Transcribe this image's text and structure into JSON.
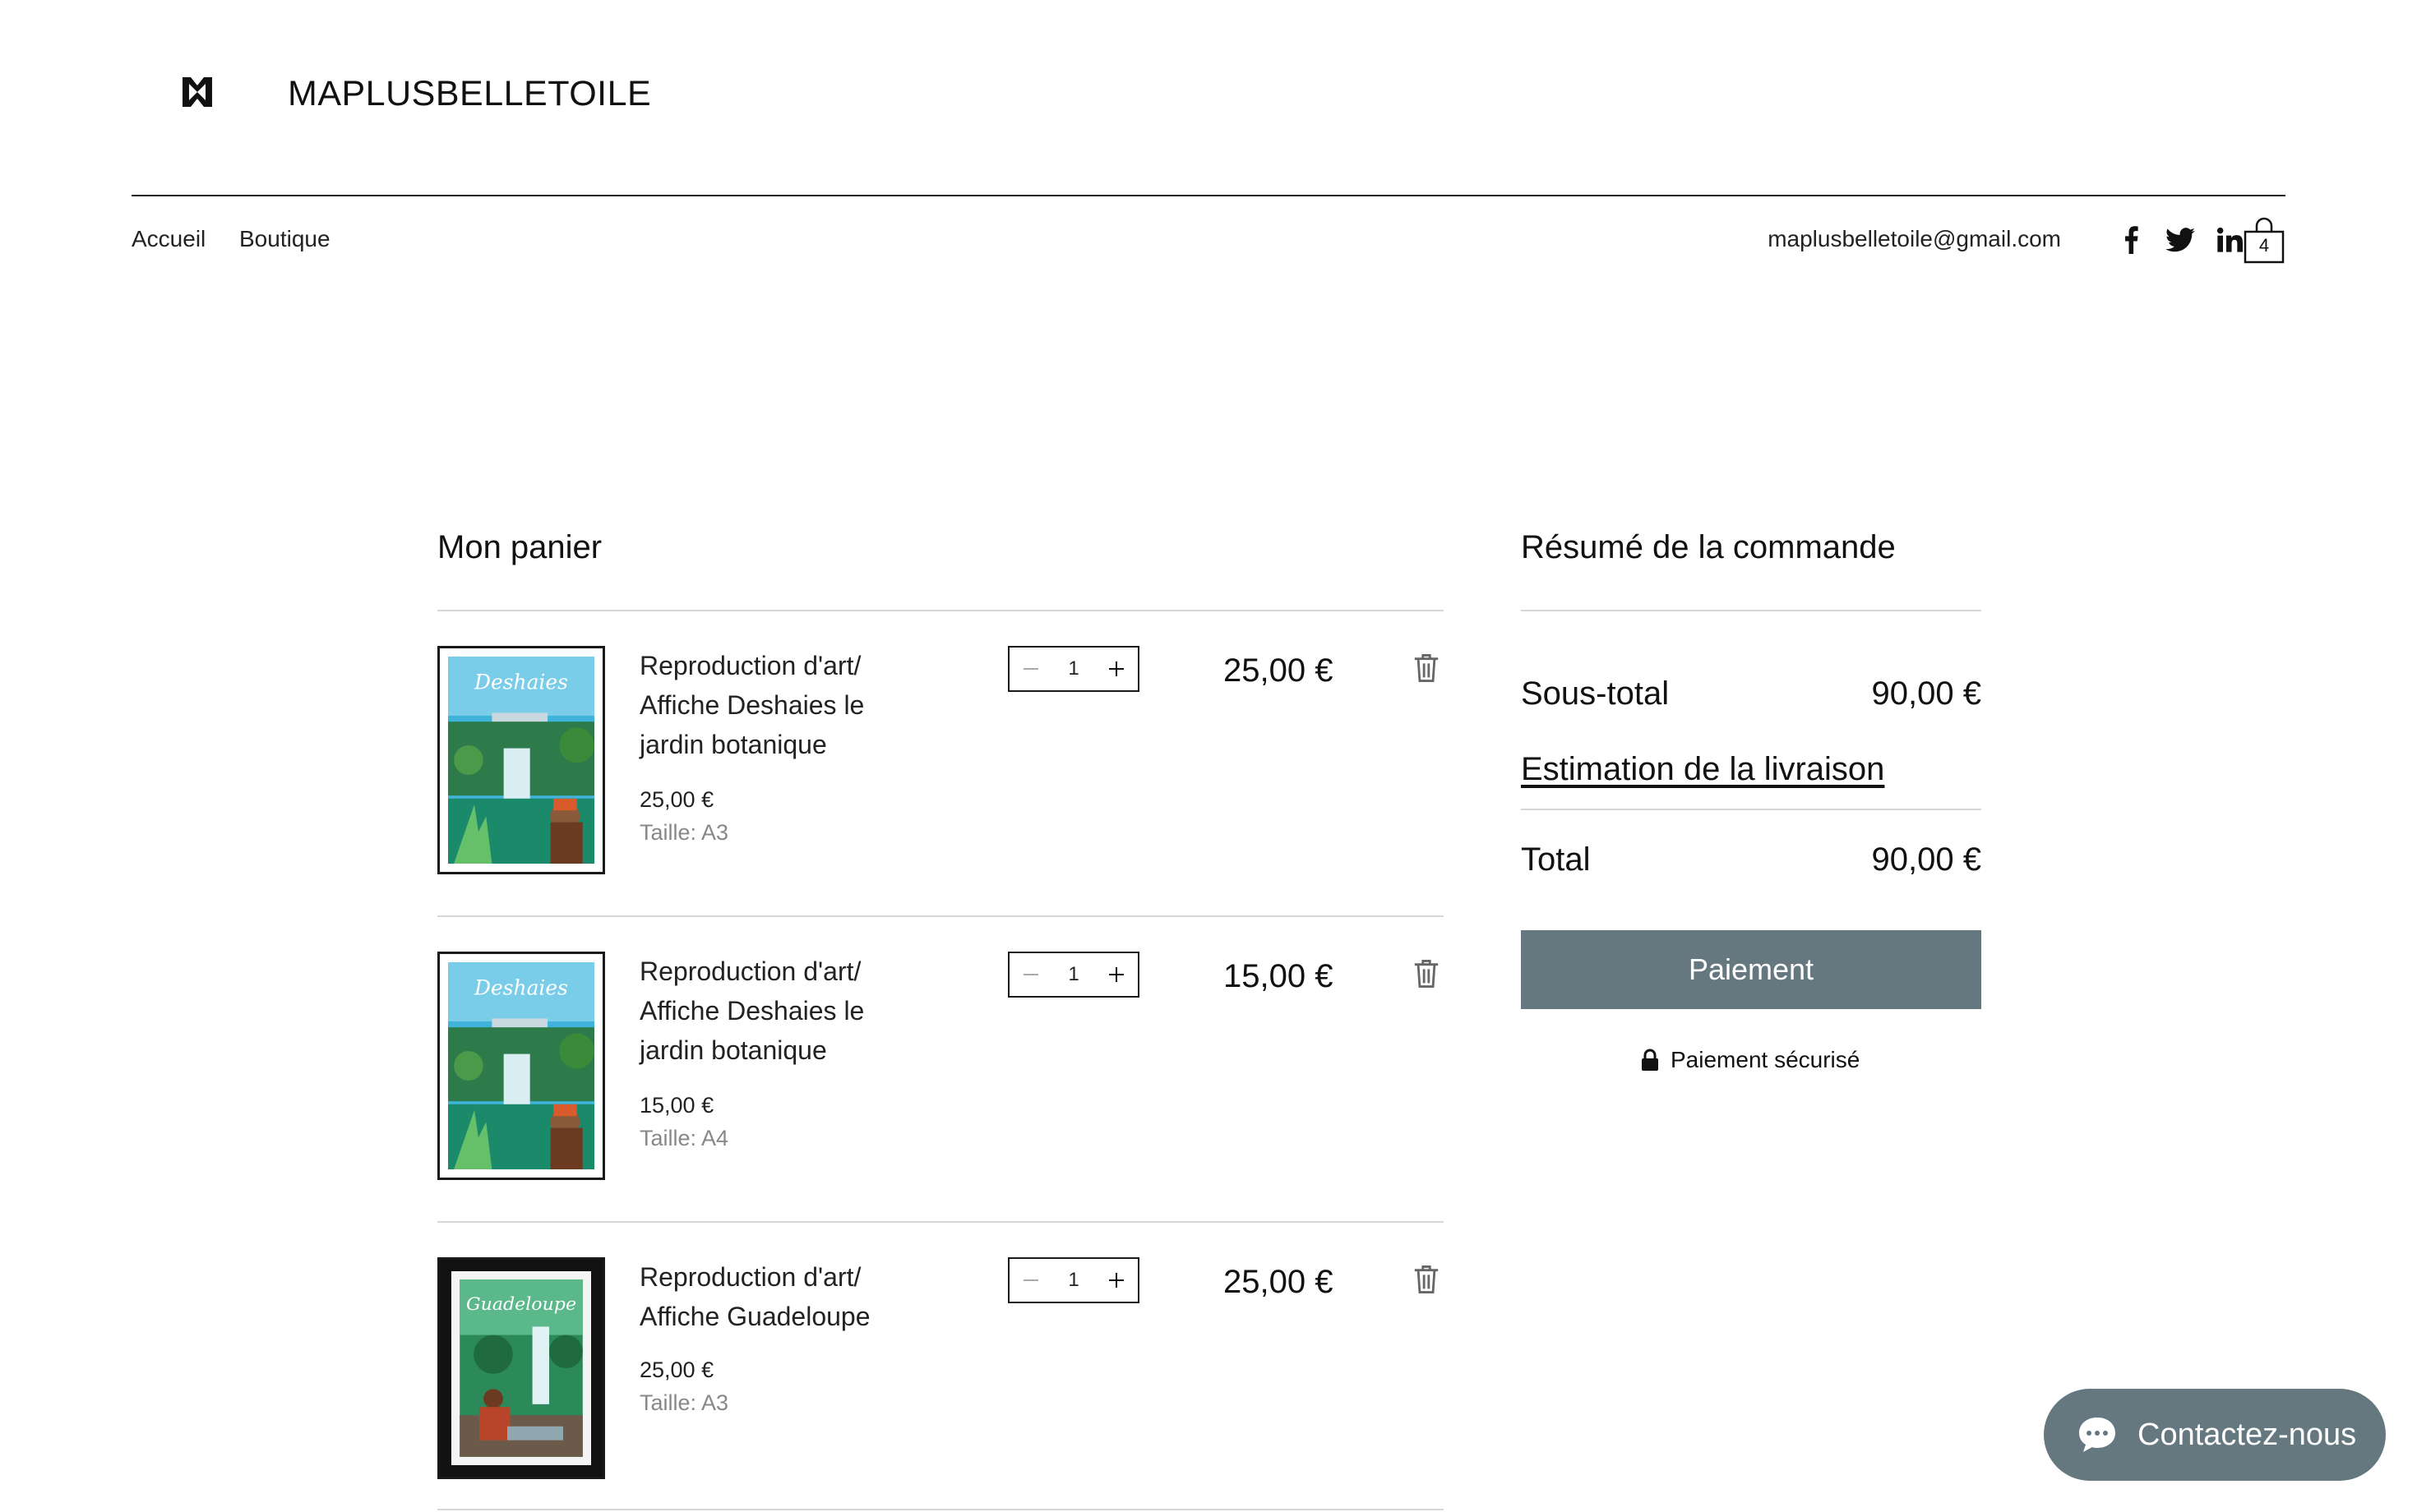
{
  "header": {
    "brand": "MAPLUSBELLETOILE",
    "nav": [
      "Accueil",
      "Boutique"
    ],
    "email": "maplusbelletoile@gmail.com",
    "social_icons": [
      "facebook-icon",
      "twitter-icon",
      "linkedin-icon"
    ],
    "cart_count": "4"
  },
  "cart": {
    "title": "Mon panier",
    "items": [
      {
        "name": "Reproduction d'art/ Affiche Deshaies le jardin botanique",
        "price": "25,00 €",
        "size": "Taille: A3",
        "quantity": "1",
        "line_total": "25,00 €",
        "poster_text": "Deshaies"
      },
      {
        "name": "Reproduction d'art/ Affiche Deshaies le jardin botanique",
        "price": "15,00 €",
        "size": "Taille: A4",
        "quantity": "1",
        "line_total": "15,00 €",
        "poster_text": "Deshaies"
      },
      {
        "name": "Reproduction d'art/ Affiche Guadeloupe",
        "price": "25,00 €",
        "size": "Taille: A3",
        "quantity": "1",
        "line_total": "25,00 €",
        "poster_text": "Guadeloupe"
      }
    ]
  },
  "summary": {
    "title": "Résumé de la commande",
    "subtotal_label": "Sous-total",
    "subtotal_value": "90,00 €",
    "shipping_label": "Estimation de la livraison",
    "total_label": "Total",
    "total_value": "90,00 €",
    "checkout_label": "Paiement",
    "secure_label": "Paiement sécurisé"
  },
  "chat": {
    "label": "Contactez-nous"
  },
  "colors": {
    "accent": "#66787f",
    "text": "#111111",
    "divider": "#d6d6d6"
  }
}
